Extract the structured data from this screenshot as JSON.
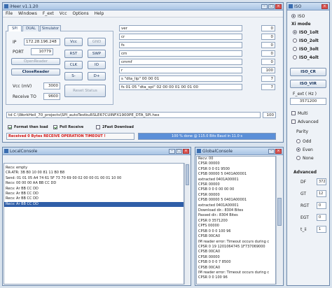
{
  "main_window": {
    "title": "iHeer v1.1.20",
    "menu": [
      "File",
      "Windows",
      "F_ext",
      "Vcc",
      "Options",
      "Help"
    ],
    "tabs": [
      "SPI",
      "DUAL",
      "Simulator"
    ],
    "ip_label": "IP",
    "ip_value": "172.28.196.248",
    "port_label": "PORT",
    "port_value": "10779",
    "open_reader": "OpenReader",
    "close_reader": "CloseReader",
    "vcc_label": "Vcc (mV)",
    "vcc_value": "3000",
    "receive_label": "Receive TO",
    "receive_value": "9600",
    "buttons": {
      "vcc": "Vcc",
      "gnd": "GND",
      "rst": "RST",
      "swp": "SWP",
      "clk": "CLK",
      "io": "IO",
      "s": "S-",
      "dplus": "D+",
      "reset_status": "Reset Status"
    },
    "cmd_rows": [
      {
        "text": "ver",
        "value": "0"
      },
      {
        "text": "cr",
        "value": "0"
      },
      {
        "text": "fs",
        "value": "0"
      },
      {
        "text": "cm",
        "value": "0"
      },
      {
        "text": "cmmf",
        "value": "0"
      },
      {
        "text": "r",
        "value": "100"
      },
      {
        "text": "s \"dta_lip\" 00 00 01",
        "value": "7"
      },
      {
        "text": "fs 01 05 \"dta_spi\" 02 00 00 01 00 01 00",
        "value": "7"
      }
    ],
    "path_value": "td C:\\WorkHeil_70_projects\\SPI_autoTestkuRSLE67CUINFX1900PE_DTA_SPI.hex",
    "path_num": "100",
    "format_then_load": "Format then load",
    "poll_receive": "Poll Receive",
    "fast_download": "2Fast Download",
    "status_text": "Received 0 Bytes RECEIVE OPERATION TIMEOUT !",
    "progress_text": "100 % done @ 115.0 Bits Baud in 11.0 s",
    "progress": 1.0
  },
  "local_console": {
    "title": "LocalConsole",
    "lines": [
      "Recv: empty",
      "CR-ATR: 3B B0 10 00 81 11 B0 B8",
      "Send: 01 01 05 A4 74 61 5F 73 70 69 00 02 00 00 01 00 01 10 00",
      "Recv: 00 00 00 AA BB CC DD",
      "Recv: Ar BB CC DD",
      "Recv: Ar BB CC DD",
      "Recv: Ar BB CC DD",
      "Recv: Ar BB CC DD"
    ],
    "selected_index": 7
  },
  "global_console": {
    "title": "GlobalConsole",
    "lines": [
      "Recv: 00",
      "CPSR 00000",
      "CPSR 0 0 01 9500",
      "CPSB 00000 5 0401A00001",
      "extracted 0401A00001",
      "CPSR 00000",
      "CPSB 0 0 0 00 00 00",
      "CPSR 00000",
      "CPSB 00000 5 0401A00001",
      "extracted 0401A00001",
      "Download dir.: 8304 Bites",
      "Passed dir.: 8304 Bites",
      "CPSR 0 3571200",
      "CPFS 00000",
      "CPSB 0 0 0 100 96",
      "CPSB 00CA0",
      "IM reader error: Timeout occurs during c",
      "CPSR 0 19 1201064745 1F737069000",
      "CPSB 00CA0",
      "CPSR 00000",
      "CPSB 0 0 0 7 8500",
      "CPSB 00CA0",
      "IM reader error: Timeout occurs during c",
      "CPSR 0 0 100 96"
    ]
  },
  "iso_panel": {
    "title": "ISO",
    "iso_label": "ISO",
    "xi_mode": "Xi mode",
    "modes": [
      "ISO_1olt",
      "ISO_2olt",
      "ISO_3olt",
      "ISO_4olt"
    ],
    "selected_mode": 0,
    "iso_cr": "ISO_CR",
    "iso_vir": "ISO_VIR",
    "fext_label": "F_ext ( Hz )",
    "fext_value": "3571200",
    "multi": "Multi",
    "advanced": "Advanced",
    "parity_label": "Parity",
    "parity": [
      "Odd",
      "Even",
      "None"
    ],
    "parity_selected": 1,
    "advanced_label": "Advanced",
    "adv_rows": [
      {
        "label": "DF",
        "value": "372"
      },
      {
        "label": "GT",
        "value": "12"
      },
      {
        "label": "RGT",
        "value": "0"
      },
      {
        "label": "EGT",
        "value": "0"
      },
      {
        "label": "t_ii",
        "value": "1"
      }
    ]
  },
  "colors": {
    "status_red": "#d01010",
    "progress": "#5b8fd8",
    "selection": "#2f5ea8"
  }
}
